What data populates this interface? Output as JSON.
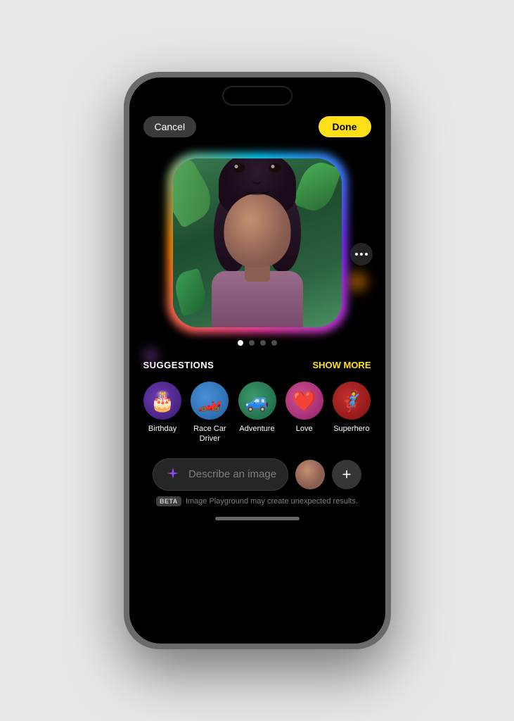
{
  "phone": {
    "title": "Image Playground"
  },
  "header": {
    "cancel_label": "Cancel",
    "done_label": "Done"
  },
  "image": {
    "alt": "AI generated portrait of a young woman with curly hair surrounded by plants"
  },
  "pagination": {
    "total": 4,
    "active": 0
  },
  "suggestions": {
    "title": "SUGGESTIONS",
    "show_more_label": "SHOW MORE",
    "items": [
      {
        "id": "birthday",
        "label": "Birthday",
        "emoji": "🎂",
        "color_class": "icon-birthday"
      },
      {
        "id": "racecar",
        "label": "Race Car\nDriver",
        "emoji": "🏎️",
        "color_class": "icon-racecar"
      },
      {
        "id": "adventure",
        "label": "Adventure",
        "emoji": "🚙",
        "color_class": "icon-adventure"
      },
      {
        "id": "love",
        "label": "Love",
        "emoji": "❤️",
        "color_class": "icon-love"
      },
      {
        "id": "superhero",
        "label": "Superhero",
        "emoji": "🦸",
        "color_class": "icon-superhero"
      }
    ]
  },
  "input": {
    "placeholder": "Describe an image"
  },
  "beta": {
    "badge": "BETA",
    "message": "Image Playground may create unexpected results."
  },
  "colors": {
    "done_bg": "#FFE017",
    "done_text": "#000000",
    "cancel_bg": "#3a3a3a",
    "accent_yellow": "#FFE017"
  }
}
